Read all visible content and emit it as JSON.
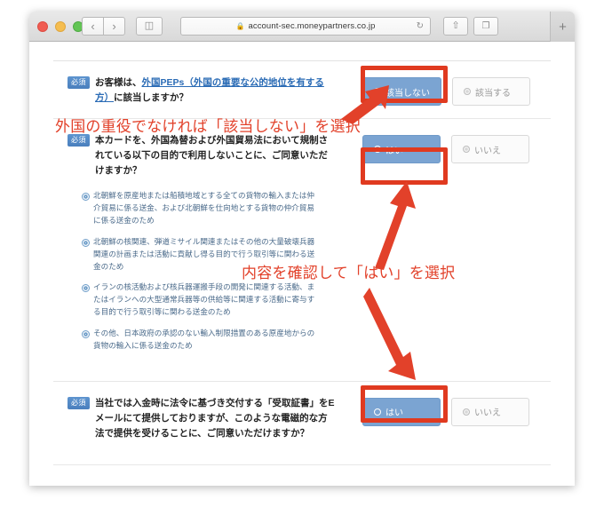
{
  "browser": {
    "url": "account-sec.moneypartners.co.jp",
    "lock_icon": "lock-icon",
    "reload_icon": "reload-icon",
    "back_icon": "‹",
    "forward_icon": "›",
    "sidebar_icon": "◫",
    "share_icon": "⇧",
    "tabs_icon": "❐",
    "new_tab_icon": "+"
  },
  "form": {
    "required_badge": "必須",
    "questions": [
      {
        "text_before_link": "お客様は、",
        "link_text": "外国PEPs（外国の重要な公的地位を有する方）",
        "text_after_link": "に該当しますか？",
        "options": [
          {
            "label": "該当しない",
            "selected": true
          },
          {
            "label": "該当する",
            "selected": false
          }
        ]
      },
      {
        "text": "本カードを、外国為替および外国貿易法において規制されている以下の目的で利用しないことに、ご同意いただけますか？",
        "bullets": [
          "北朝鮮を原産地または船積地域とする全ての貨物の輸入または仲介貿易に係る送金、および北朝鮮を仕向地とする貨物の仲介貿易に係る送金のため",
          "北朝鮮の核関連、弾道ミサイル関連またはその他の大量破壊兵器関連の計画または活動に貢献し得る目的で行う取引等に関わる送金のため",
          "イランの核活動および核兵器運搬手段の開発に関連する活動、またはイランへの大型通常兵器等の供給等に関連する活動に寄与する目的で行う取引等に関わる送金のため",
          "その他、日本政府の承認のない輸入制限措置のある原産地からの貨物の輸入に係る送金のため"
        ],
        "options": [
          {
            "label": "はい",
            "selected": true
          },
          {
            "label": "いいえ",
            "selected": false
          }
        ]
      },
      {
        "text": "当社では入金時に法令に基づき交付する「受取証書」をEメールにて提供しておりますが、このような電磁的な方法で提供を受けることに、ご同意いただけますか？",
        "options": [
          {
            "label": "はい",
            "selected": true
          },
          {
            "label": "いいえ",
            "selected": false
          }
        ]
      }
    ]
  },
  "annotations": {
    "note_1": "外国の重役でなければ「該当しない」を選択",
    "note_2": "内容を確認して「はい」を選択"
  },
  "colors": {
    "accent_blue": "#7ba4d2",
    "annotation_red": "#e2412a",
    "link_blue": "#2a6bb5",
    "bullet_text": "#4a6a8a"
  }
}
